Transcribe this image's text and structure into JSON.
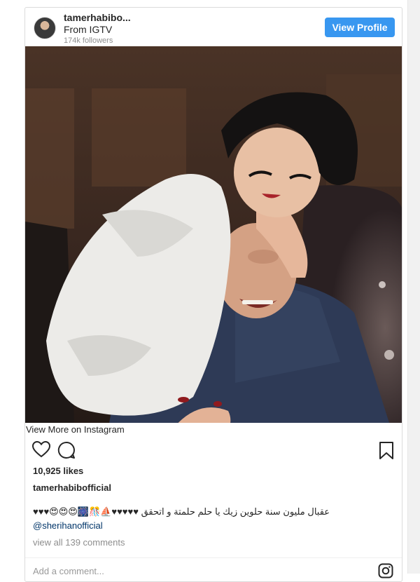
{
  "header": {
    "username": "tamerhabibo...",
    "source": "From IGTV",
    "followers": "174k followers",
    "view_profile_label": "View Profile"
  },
  "post": {
    "view_more_label": "View More on Instagram",
    "likes": "10,925 likes",
    "owner": "tamerhabibofficial",
    "caption": "♥♥♥😍😍😍🎆🎊⛵♥♥♥♥♥ عقبال مليون سنة حلوين زيك يا حلم حلمتة و اتحقق",
    "mention": "@sherihanofficial",
    "comments_link": "view all 139 comments",
    "add_comment_placeholder": "Add a comment..."
  },
  "icons": {
    "like": "heart-icon",
    "comment": "comment-icon",
    "save": "bookmark-icon",
    "instagram": "instagram-icon"
  },
  "colors": {
    "accent": "#3897f0",
    "mention": "#003569",
    "muted": "#8e8e8e"
  }
}
